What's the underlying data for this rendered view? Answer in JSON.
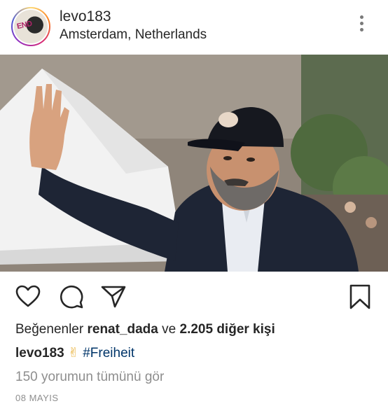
{
  "header": {
    "username": "levo183",
    "location": "Amsterdam, Netherlands",
    "avatar_text": "END"
  },
  "post": {
    "photo_icon": "photo-of-man-waving",
    "actions": {
      "like_icon": "heart-icon",
      "comment_icon": "comment-icon",
      "share_icon": "share-icon",
      "save_icon": "bookmark-icon"
    },
    "likes": {
      "prefix": "Beğenenler",
      "user": "renat_dada",
      "middle": "ve",
      "count": "2.205 diğer kişi"
    },
    "caption": {
      "user": "levo183",
      "emoji": "✌",
      "hashtag": "#Freiheit"
    },
    "comments_link": "150 yorumun tümünü gör",
    "date": "08 MAYIS"
  },
  "colors": {
    "text": "#262626",
    "muted": "#8e8e8e",
    "hashtag": "#003569"
  }
}
